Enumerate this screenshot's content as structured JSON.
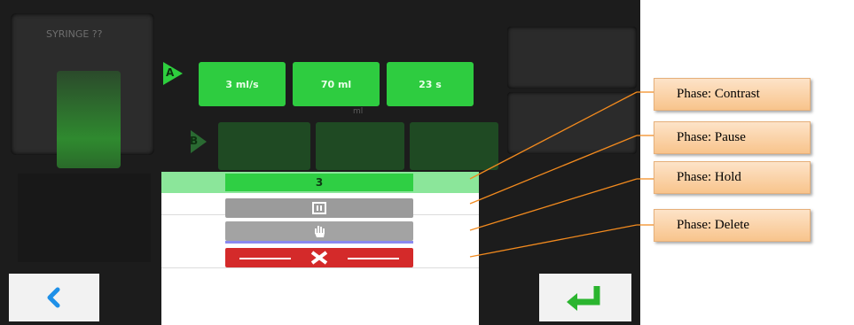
{
  "screen": {
    "title": "",
    "syringe_label": "SYRINGE ??",
    "row_a_marker": "A",
    "row_b_marker": "B",
    "params": [
      "3 ml/s",
      "70 ml",
      "23 s"
    ],
    "volume_sub": "ml"
  },
  "popup": {
    "header_value": "3"
  },
  "callouts": {
    "contrast": "Phase: Contrast",
    "pause": "Phase: Pause",
    "hold": "Phase: Hold",
    "delete": "Phase: Delete"
  },
  "colors": {
    "accent_green": "#2ecc40",
    "delete_red": "#d42a2a",
    "callout_orange": "#f8c48c",
    "leader_orange": "#f28a1e",
    "back_icon_blue": "#1e90e8",
    "enter_icon_green": "#2bb52f"
  },
  "icons": {
    "back": "chevron-left-icon",
    "enter": "enter-return-icon",
    "pause": "pause-icon",
    "hold": "hand-icon",
    "delete": "close-icon"
  }
}
